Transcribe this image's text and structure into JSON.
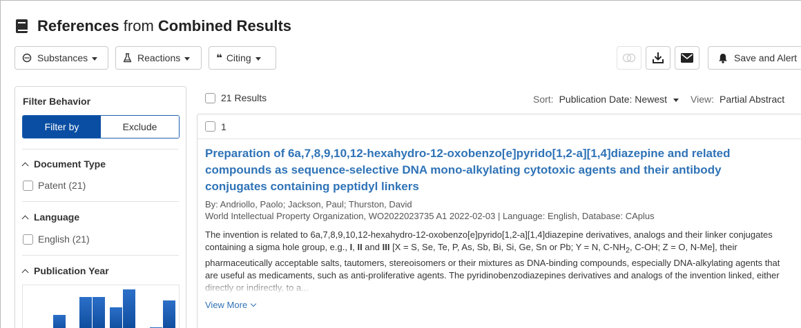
{
  "header": {
    "title_part1": "References",
    "title_part2": "from",
    "title_part3": "Combined Results"
  },
  "toolbar": {
    "substances_label": "Substances",
    "reactions_label": "Reactions",
    "citing_label": "Citing",
    "save_alert_label": "Save and Alert",
    "icons": [
      "combine-icon",
      "download-icon",
      "email-icon",
      "bell-icon"
    ]
  },
  "sidebar": {
    "filter_behavior": "Filter Behavior",
    "filter_by": "Filter by",
    "exclude": "Exclude",
    "sections": [
      {
        "title": "Document Type",
        "option": "Patent (21)"
      },
      {
        "title": "Language",
        "option": "English (21)"
      },
      {
        "title": "Publication Year"
      }
    ],
    "histogram_bar_levels": [
      0.4,
      0.82,
      0.82,
      0.58,
      1.0,
      0.12,
      0.74
    ]
  },
  "results": {
    "count_label": "21 Results",
    "sort_label": "Sort:",
    "sort_value": "Publication Date: Newest",
    "view_label": "View:",
    "view_value": "Partial Abstract",
    "item_number": "1",
    "item": {
      "title": "Preparation of 6a,7,8,9,10,12-hexahydro-12-oxobenzo[e]pyrido[1,2-a][1,4]diazepine and related compounds as sequence-selective DNA mono-alkylating cytotoxic agents and their antibody conjugates containing peptidyl linkers",
      "authors": "By: Andriollo, Paolo; Jackson, Paul; Thurston, David",
      "source": "World Intellectual Property Organization, WO2022023735 A1 2022-02-03 | Language: English, Database: CAplus",
      "abstract_p1": "The invention is related to 6a,7,8,9,10,12-hexahydro-12-oxobenzo[e]pyrido[1,2-a][1,4]diazepine derivatives, analogs and their linker conjugates containing a sigma hole group, e.g., ",
      "abstract_bold1": "I",
      "abstract_sep1": ", ",
      "abstract_bold2": "II",
      "abstract_sep2": " and ",
      "abstract_bold3": "III",
      "abstract_p2": " [X = S, Se, Te, P, As, Sb, Bi, Si, Ge, Sn or Pb; Y = N, C-NH",
      "abstract_sub": "2",
      "abstract_p3": ", C-OH; Z = O, N-Me], their pharmaceutically acceptable salts, tautomers, stereoisomers or their mixtures as DNA-binding compounds, especially DNA-alkylating agents that are useful as medicaments, such as anti-proliferative agents. The pyridinobenzodiazepines derivatives and analogs of the invention linked, either directly or indirectly, to a...",
      "view_more": "View More"
    }
  }
}
